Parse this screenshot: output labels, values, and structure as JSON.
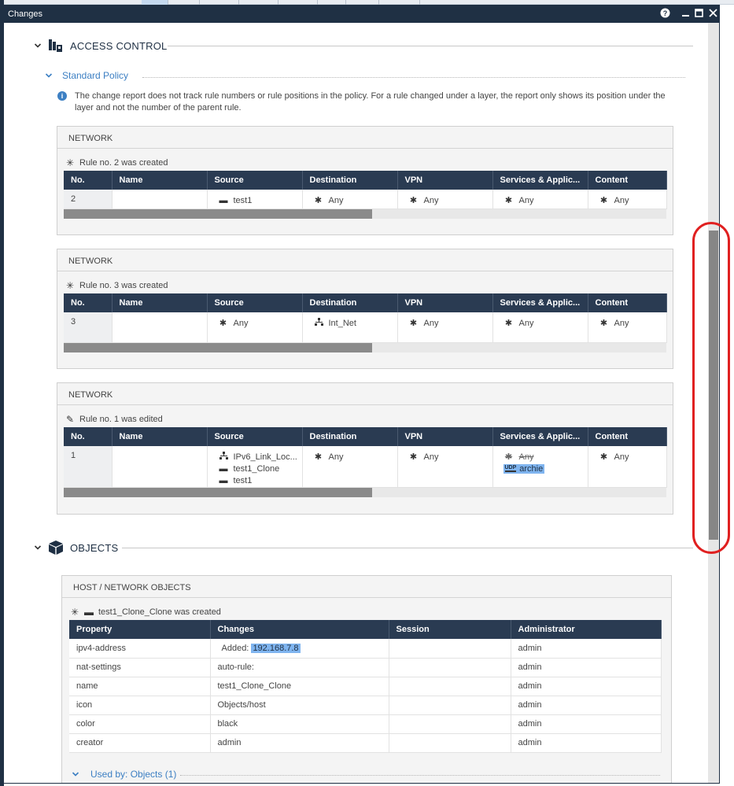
{
  "window": {
    "title": "Changes"
  },
  "access_control": {
    "title": "ACCESS CONTROL",
    "policy": "Standard Policy",
    "info": "The change report does not track rule numbers or rule positions in the policy. For a rule changed under a layer, the report only shows its position under the layer and not the number of the parent rule.",
    "columns": [
      "No.",
      "Name",
      "Source",
      "Destination",
      "VPN",
      "Services & Applic...",
      "Content"
    ],
    "blocks": [
      {
        "header": "NETWORK",
        "event_icon": "asterisk-icon",
        "event": "Rule no. 2 was created",
        "row": {
          "no": "2",
          "name": "",
          "source": [
            "test1"
          ],
          "destination": [
            "Any"
          ],
          "vpn": [
            "Any"
          ],
          "services": [
            "Any"
          ],
          "content": [
            "Any"
          ]
        }
      },
      {
        "header": "NETWORK",
        "event_icon": "asterisk-icon",
        "event": "Rule no. 3 was created",
        "row": {
          "no": "3",
          "name": "",
          "source": [
            "Any"
          ],
          "destination": [
            "Int_Net"
          ],
          "vpn": [
            "Any"
          ],
          "services": [
            "Any"
          ],
          "content": [
            "Any"
          ]
        }
      },
      {
        "header": "NETWORK",
        "event_icon": "pencil-icon",
        "event": "Rule no. 1 was edited",
        "row": {
          "no": "1",
          "name": "",
          "source": [
            "IPv6_Link_Loc...",
            "test1_Clone",
            "test1"
          ],
          "destination": [
            "Any"
          ],
          "vpn": [
            "Any"
          ],
          "services_removed": "Any",
          "services_added": "archie",
          "services_added_tag": "UDP",
          "content": [
            "Any"
          ]
        }
      }
    ]
  },
  "objects": {
    "title": "OBJECTS",
    "box_header": "HOST / NETWORK OBJECTS",
    "event": "test1_Clone_Clone was created",
    "columns": [
      "Property",
      "Changes",
      "Session",
      "Administrator"
    ],
    "rows": [
      {
        "property": "ipv4-address",
        "change_prefix": "Added:",
        "change_value": "192.168.7.8",
        "session": "",
        "admin": "admin"
      },
      {
        "property": "nat-settings",
        "change_prefix": "",
        "change_value": "auto-rule:",
        "session": "",
        "admin": "admin"
      },
      {
        "property": "name",
        "change_prefix": "",
        "change_value": "test1_Clone_Clone",
        "session": "",
        "admin": "admin"
      },
      {
        "property": "icon",
        "change_prefix": "",
        "change_value": "Objects/host",
        "session": "",
        "admin": "admin"
      },
      {
        "property": "color",
        "change_prefix": "",
        "change_value": "black",
        "session": "",
        "admin": "admin"
      },
      {
        "property": "creator",
        "change_prefix": "",
        "change_value": "admin",
        "session": "",
        "admin": "admin"
      }
    ],
    "used_by": "Used by: Objects (1)"
  },
  "colors": {
    "header_bg": "#2a3b52",
    "titlebar": "#1f3044",
    "link": "#3c7fc3",
    "selection": "#7fb4ef",
    "annotation": "#e02020"
  }
}
